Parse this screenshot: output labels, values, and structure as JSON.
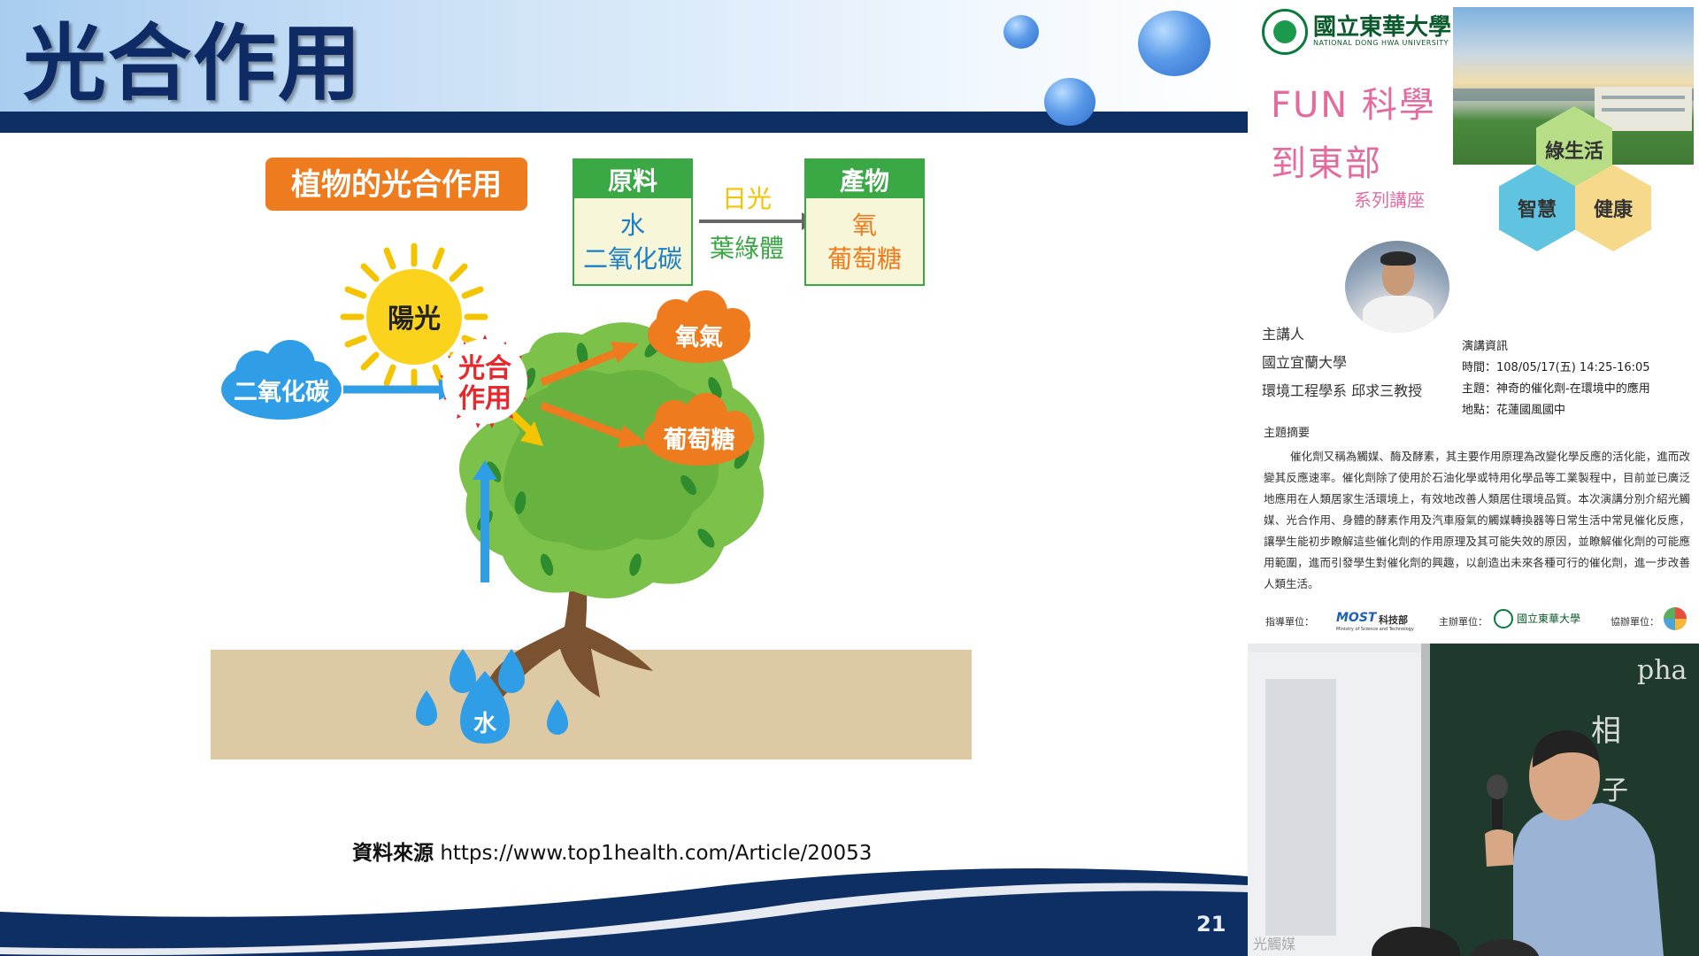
{
  "slide": {
    "title": "光合作用",
    "page_number": "21",
    "source_label": "資料來源",
    "source_url": "https://www.top1health.com/Article/20053",
    "diagram": {
      "heading": "植物的光合作用",
      "raw_header": "原料",
      "raw_items": [
        "水",
        "二氧化碳"
      ],
      "condition_top": "日光",
      "condition_bottom": "葉綠體",
      "product_header": "產物",
      "product_items": [
        "氧",
        "葡萄糖"
      ],
      "sun_label": "陽光",
      "center_line1": "光合",
      "center_line2": "作用",
      "co2_label": "二氧化碳",
      "oxygen_label": "氧氣",
      "glucose_label": "葡萄糖",
      "water_label": "水"
    }
  },
  "poster": {
    "university_zh": "國立東華大學",
    "university_en": "NATIONAL DONG HWA UNIVERSITY",
    "fun_line1": "FUN 科學",
    "fun_line2": "到東部",
    "series": "系列講座",
    "hex_green": "綠生活",
    "hex_blue": "智慧",
    "hex_yellow": "健康",
    "speaker_role": "主講人",
    "speaker_school": "國立宜蘭大學",
    "speaker_dept": "環境工程學系  邱求三教授",
    "info_title": "演講資訊",
    "info_time": "時間：108/05/17(五)  14:25-16:05",
    "info_topic": "主題：神奇的催化劑-在環境中的應用",
    "info_place": "地點：花蓮國風國中",
    "abstract_title": "主題摘要",
    "abstract": "催化劑又稱為觸媒、酶及酵素，其主要作用原理為改變化學反應的活化能，進而改變其反應速率。催化劑除了使用於石油化學或特用化學品等工業製程中，目前並已廣泛地應用在人類居家生活環境上，有效地改善人類居住環境品質。本次演講分別介紹光觸媒、光合作用、身體的酵素作用及汽車廢氣的觸媒轉換器等日常生活中常見催化反應，讓學生能初步瞭解這些催化劑的作用原理及其可能失效的原因，並瞭解催化劑的可能應用範圍，進而引發學生對催化劑的興趣，以創造出未來各種可行的催化劑，進一步改善人類生活。",
    "guide_label": "指導單位：",
    "most_logo": "MOST",
    "most_name": "科技部",
    "most_en": "Ministry of Science and Technology",
    "host_label": "主辦單位：",
    "host_name": "國立東華大學",
    "co_label": "協辦單位："
  },
  "photo": {
    "board_text_1": "pha",
    "board_text_2": "相",
    "board_text_3": "子",
    "screen_text": "光觸媒"
  },
  "colors": {
    "navy": "#0e2f63",
    "title_blue": "#0f2b66",
    "orange": "#ef7b1f",
    "green": "#3aa845",
    "pink": "#e46ba0"
  }
}
